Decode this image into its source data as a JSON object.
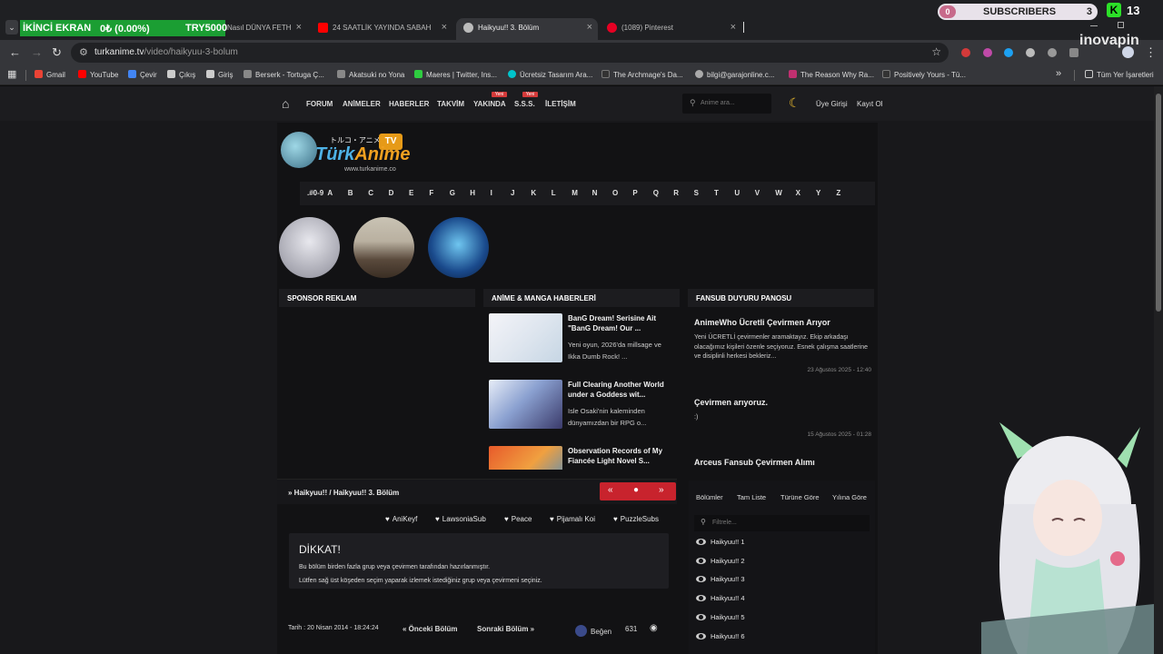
{
  "browser": {
    "overlay": {
      "label": "İKİNCİ EKRAN",
      "progress": "0₺ (0.00%)",
      "goal": "TRY5000"
    },
    "tabs": [
      {
        "title": "Nasıl DÜNYA FETH",
        "favicon_color": "#999999"
      },
      {
        "title": "24 SAATLİK YAYINDA SABAH 7'...",
        "favicon_color": "#ff0000"
      },
      {
        "title": "Haikyuu!! 3. Bölüm",
        "favicon_color": "#bbbbbb"
      },
      {
        "title": "(1089) Pinterest",
        "favicon_color": "#e60023"
      }
    ],
    "subscribers": {
      "pill": "0",
      "label": "SUBSCRIBERS",
      "count": "3"
    },
    "kick": {
      "icon": "K",
      "count": "13"
    },
    "url_domain": "turkanime.tv",
    "url_path": "/video/haikyuu-3-bolum",
    "watermark": "inovapin",
    "bookmarks": [
      {
        "label": "Gmail",
        "color": "#ea4335"
      },
      {
        "label": "YouTube",
        "color": "#ff0000"
      },
      {
        "label": "Çevir",
        "color": "#4285f4"
      },
      {
        "label": "Çıkış",
        "color": "#cccccc"
      },
      {
        "label": "Giriş",
        "color": "#cccccc"
      },
      {
        "label": "Berserk - Tortuga Ç...",
        "color": "#888888"
      },
      {
        "label": "Akatsuki no Yona",
        "color": "#888888"
      },
      {
        "label": "Maeres | Twitter, Ins...",
        "color": "#2ecc40"
      },
      {
        "label": "Ücretsiz Tasarım Ara...",
        "color": "#00c4cc"
      },
      {
        "label": "The Archmage's Da...",
        "color": "#333333"
      },
      {
        "label": "bilgi@garajonline.c...",
        "color": "#aaaaaa"
      },
      {
        "label": "The Reason Why Ra...",
        "color": "#c03070"
      },
      {
        "label": "Positively Yours - Tü...",
        "color": "#333333"
      }
    ],
    "all_bookmarks": "Tüm Yer İşaretleri"
  },
  "site": {
    "nav": {
      "links": [
        "FORUM",
        "ANİMELER",
        "HABERLER",
        "TAKVİM",
        "YAKINDA",
        "S.S.S.",
        "İLETİŞİM"
      ],
      "badge": "Yeni",
      "search_placeholder": "Anime ara...",
      "login": "Üye Girişi",
      "register": "Kayıt Ol"
    },
    "logo": {
      "jp": "トルコ・アニメ",
      "name_a": "Türk",
      "name_b": "Anime",
      "tv": "TV",
      "url": "www.turkanime.co"
    },
    "alphabet": [
      ".#0-9",
      "A",
      "B",
      "C",
      "D",
      "E",
      "F",
      "G",
      "H",
      "I",
      "J",
      "K",
      "L",
      "M",
      "N",
      "O",
      "P",
      "Q",
      "R",
      "S",
      "T",
      "U",
      "V",
      "W",
      "X",
      "Y",
      "Z"
    ],
    "panels": {
      "sponsor": "SPONSOR REKLAM",
      "news": "ANİME & MANGA HABERLERİ",
      "fansub": "FANSUB DUYURU PANOSU"
    },
    "news": [
      {
        "title": "BanG Dream! Serisine Ait \"BanG Dream! Our ...",
        "desc": "Yeni oyun, 2026'da millsage ve Ikka Dumb Rock! ..."
      },
      {
        "title": "Full Clearing Another World under a Goddess wit...",
        "desc": "Isle Osaki'nin kaleminden dünyamızdan bir RPG o..."
      },
      {
        "title": "Observation Records of My Fiancée Light Novel S...",
        "desc": ""
      }
    ],
    "fansub": [
      {
        "title": "AnimeWho Ücretli Çevirmen Arıyor",
        "desc": "Yeni ÜCRETLİ çevirmenler aramaktayız. Ekip arkadaşı olacağımız kişileri özenle seçiyoruz. Esnek çalışma saatlerine ve disiplinli herkesi bekleriz...",
        "date": "23 Ağustos 2025 - 12:40"
      },
      {
        "title": "Çevirmen arıyoruz.",
        "desc": ":)",
        "date": "15 Ağustos 2025 - 01:28"
      },
      {
        "title": "Arceus Fansub Çevirmen Alımı",
        "desc": "",
        "date": ""
      }
    ],
    "breadcrumb": {
      "anime": "Haikyuu!!",
      "sep": "/",
      "episode": "Haikyuu!! 3. Bölüm"
    },
    "groups": [
      "AniKeyf",
      "LawsoniaSub",
      "Peace",
      "Pijamalı Koi",
      "PuzzleSubs"
    ],
    "notice": {
      "title": "DİKKAT!",
      "line1": "Bu bölüm birden fazla grup veya çevirmen tarafından hazırlanmıştır.",
      "line2": "Lütfen sağ üst köşeden seçim yaparak izlemek istediğiniz grup veya çevirmeni seçiniz."
    },
    "bottom": {
      "date": "Tarih : 20 Nisan 2014 - 18:24:24",
      "prev": "Önceki Bölüm",
      "next": "Sonraki Bölüm",
      "like": "Beğen",
      "likes": "631"
    },
    "episode_tabs": [
      "Bölümler",
      "Tam Liste",
      "Türüne Göre",
      "Yılına Göre"
    ],
    "filter_placeholder": "Filtrele...",
    "episodes": [
      "Haikyuu!! 1",
      "Haikyuu!! 2",
      "Haikyuu!! 3",
      "Haikyuu!! 4",
      "Haikyuu!! 5",
      "Haikyuu!! 6"
    ]
  }
}
